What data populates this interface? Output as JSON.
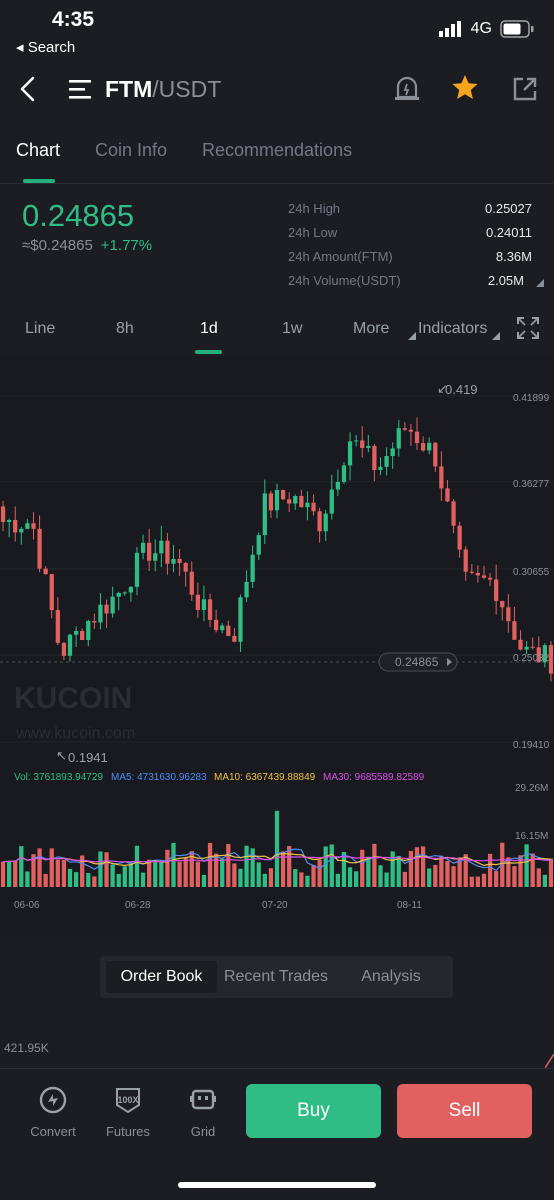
{
  "status": {
    "time": "4:35",
    "back_label": "◂ Search",
    "network": "4G"
  },
  "header": {
    "base": "FTM",
    "quote": "/USDT"
  },
  "tabs": [
    {
      "label": "Chart",
      "active": true
    },
    {
      "label": "Coin Info",
      "active": false
    },
    {
      "label": "Recommendations",
      "active": false
    }
  ],
  "ticker": {
    "price": "0.24865",
    "fiat": "≈$0.24865",
    "change": "+1.77%",
    "stats": [
      {
        "label": "24h High",
        "value": "0.25027"
      },
      {
        "label": "24h Low",
        "value": "0.24011"
      },
      {
        "label": "24h Amount(FTM)",
        "value": "8.36M"
      },
      {
        "label": "24h Volume(USDT)",
        "value": "2.05M"
      }
    ]
  },
  "intervals": {
    "line": "Line",
    "h8": "8h",
    "d1": "1d",
    "w1": "1w",
    "more": "More",
    "indicators": "Indicators"
  },
  "chart": {
    "watermark": "KUCOIN",
    "watermark_url": "www.kucoin.com",
    "high_marker": "0.419",
    "low_marker": "0.1941",
    "current_price_tag": "0.24865",
    "y_ticks": [
      "0.41899",
      "0.36277",
      "0.30655",
      "0.25032",
      "0.19410"
    ],
    "vol_ticks": [
      "29.26M",
      "16.15M"
    ],
    "x_ticks": [
      "06-06",
      "06-28",
      "07-20",
      "08-11"
    ],
    "vol_legend": {
      "vol": "Vol: 3761893.94729",
      "ma5": "MA5: 4731630.96283",
      "ma10": "MA10: 6367439.88849",
      "ma30": "MA30: 9685589.82589"
    },
    "colors": {
      "up": "#2fbd85",
      "down": "#e0615f",
      "ma5": "#4f8cf7",
      "ma10": "#f0c242",
      "ma30": "#d94fe6"
    }
  },
  "chart_data": {
    "type": "candlestick",
    "x": [
      "06-06",
      "06-28",
      "07-20",
      "08-11"
    ],
    "ylim": [
      0.1941,
      0.419
    ],
    "series": [
      {
        "name": "FTM/USDT",
        "close_values": [
          0.338,
          0.338,
          0.253,
          0.275,
          0.292,
          0.32,
          0.315,
          0.278,
          0.265,
          0.348,
          0.355,
          0.338,
          0.392,
          0.372,
          0.4,
          0.38,
          0.298,
          0.3,
          0.255,
          0.249
        ]
      }
    ],
    "volume_ylim": [
      0,
      29.26
    ]
  },
  "order_tabs": [
    {
      "label": "Order Book",
      "active": true
    },
    {
      "label": "Recent Trades",
      "active": false
    },
    {
      "label": "Analysis",
      "active": false
    }
  ],
  "depth_label": "421.95K",
  "bottom_nav": [
    {
      "label": "Convert",
      "icon": "convert-icon"
    },
    {
      "label": "Futures",
      "icon": "futures-100x-icon"
    },
    {
      "label": "Grid",
      "icon": "grid-bot-icon"
    }
  ],
  "actions": {
    "buy": "Buy",
    "sell": "Sell"
  }
}
